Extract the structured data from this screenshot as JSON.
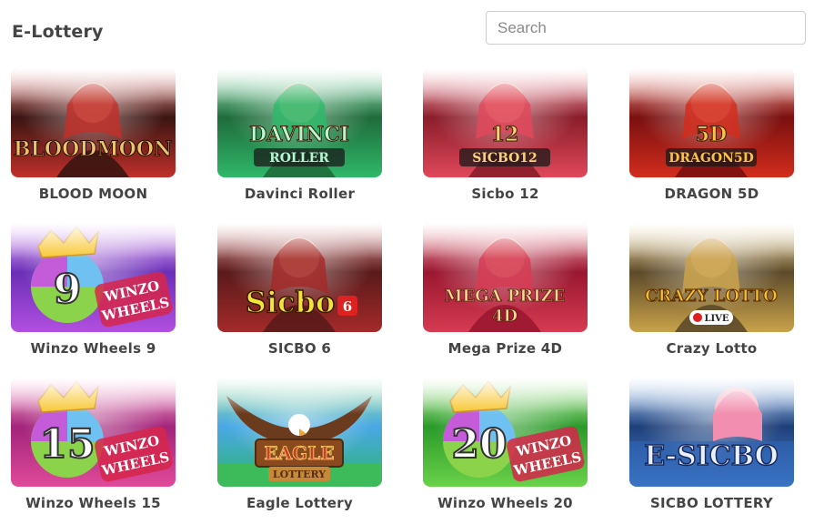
{
  "page": {
    "title": "E-Lottery"
  },
  "search": {
    "placeholder": "Search",
    "value": ""
  },
  "games": [
    {
      "name": "BLOOD MOON",
      "logo": "BLOODMOON",
      "colors": {
        "bg": "#3a1512",
        "accent": "#c0302a",
        "logo": "#e9c46a"
      }
    },
    {
      "name": "Davinci Roller",
      "logo": "DAVINCI",
      "logo2": "ROLLER",
      "colors": {
        "bg": "#1f6b3a",
        "accent": "#2fb86a",
        "logo": "#b6f5d0"
      }
    },
    {
      "name": "Sicbo 12",
      "logo": "12",
      "logo2": "SICBO12",
      "colors": {
        "bg": "#8a1d2a",
        "accent": "#e0485a",
        "logo": "#f6d27a"
      }
    },
    {
      "name": "DRAGON 5D",
      "logo": "5D",
      "logo2": "DRAGON5D",
      "colors": {
        "bg": "#7a1010",
        "accent": "#d22d1c",
        "logo": "#f5c447"
      }
    },
    {
      "name": "Winzo Wheels 9",
      "logo": "9",
      "logo2": "WINZO WHEELS",
      "colors": {
        "bg": "#6a2fb8",
        "accent": "#b24fe0",
        "logo": "#ffffff"
      }
    },
    {
      "name": "SICBO 6",
      "logo": "Sicbo",
      "logo2": "6",
      "colors": {
        "bg": "#5a1a1a",
        "accent": "#a42a2a",
        "logo": "#f3e43a"
      }
    },
    {
      "name": "Mega Prize 4D",
      "logo": "MEGA PRIZE",
      "logo2": "4D",
      "colors": {
        "bg": "#9a1730",
        "accent": "#d63b52",
        "logo": "#f4d990"
      }
    },
    {
      "name": "Crazy Lotto",
      "logo": "CRAZY LOTTO",
      "logo2": "LIVE",
      "colors": {
        "bg": "#5c4a2a",
        "accent": "#c9a24a",
        "logo": "#f4c02a"
      }
    },
    {
      "name": "Winzo Wheels 15",
      "logo": "15",
      "logo2": "WINZO WHEELS",
      "colors": {
        "bg": "#a2247a",
        "accent": "#e04a9a",
        "logo": "#ffffff"
      }
    },
    {
      "name": "Eagle Lottery",
      "logo": "EAGLE",
      "logo2": "LOTTERY",
      "colors": {
        "bg": "#4aa8e6",
        "accent": "#2cb46a",
        "logo": "#c9402a"
      }
    },
    {
      "name": "Winzo Wheels 20",
      "logo": "20",
      "logo2": "WINZO WHEELS",
      "colors": {
        "bg": "#2a9a2a",
        "accent": "#6ad24a",
        "logo": "#ffffff"
      }
    },
    {
      "name": "SICBO LOTTERY",
      "logo": "E-SICBO",
      "colors": {
        "bg": "#1f3f7a",
        "accent": "#4a8ad6",
        "logo": "#e8f0ff"
      }
    }
  ]
}
